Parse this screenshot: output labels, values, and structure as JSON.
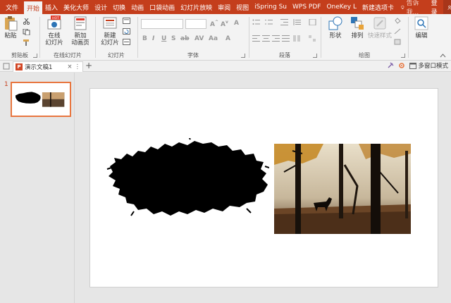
{
  "tabs": {
    "file": "文件",
    "home": "开始",
    "insert": "插入",
    "beautify": "美化大师",
    "design": "设计",
    "transitions": "切换",
    "animations": "动画",
    "pocket_animation": "口袋动画",
    "slideshow": "幻灯片放映",
    "review": "审阅",
    "view": "视图",
    "ispring": "iSpring Su",
    "wps_pdf": "WPS PDF",
    "onekey": "OneKey L",
    "new_tab": "新建选项卡",
    "tell_me": "告诉我...",
    "login": "登录",
    "share": "共享"
  },
  "ribbon": {
    "paste": "粘贴",
    "clipboard_group": "剪贴板",
    "online_slides_1": "在线",
    "online_slides_2": "幻灯片",
    "new_anim_page_1": "新加",
    "new_anim_page_2": "动画页",
    "online_slides_group": "在线幻灯片",
    "new_slide_1": "新建",
    "new_slide_2": "幻灯片",
    "slides_group": "幻灯片",
    "font_group": "字体",
    "paragraph_group": "段落",
    "shape": "形状",
    "arrange": "排列",
    "quick_styles": "快速样式",
    "drawing_group": "绘图",
    "edit": "编辑",
    "hot_badge": "HOT"
  },
  "doc": {
    "tab_title": "演示文稿1",
    "badge": "P",
    "add_tab": "+",
    "multi_window": "多窗口模式"
  },
  "thumbnails": [
    {
      "number": "1"
    }
  ],
  "colors": {
    "accent": "#c43e1c",
    "thumb_border": "#e8763f"
  },
  "icons": [
    "save-icon",
    "search-icon",
    "user-icon",
    "paste-icon",
    "shape-icon",
    "arrange-icon",
    "quick-styles-icon",
    "find-icon",
    "pin-icon",
    "gear-icon",
    "window-icon"
  ]
}
